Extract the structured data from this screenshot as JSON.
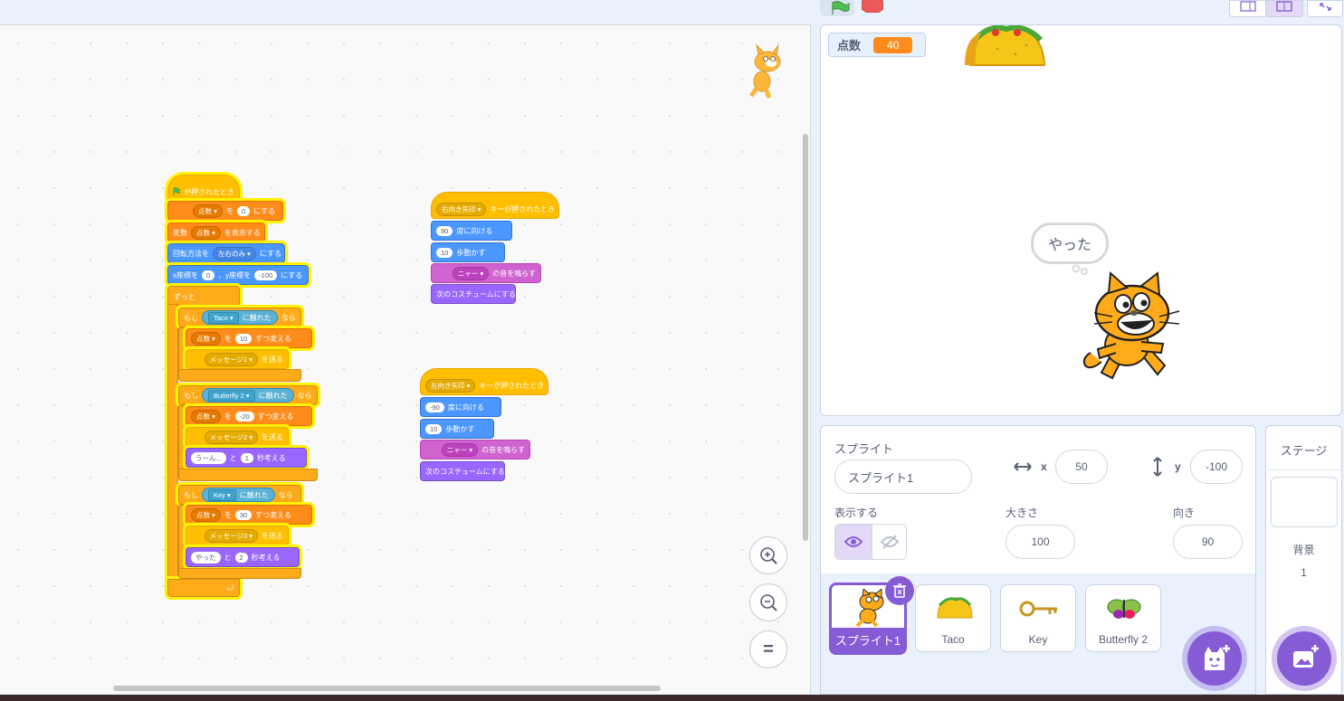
{
  "code": {
    "script1": {
      "hat": "が押されたとき",
      "b1": {
        "var": "点数",
        "text1": "を",
        "value": "0",
        "text2": "にする"
      },
      "b2": {
        "text1": "変数",
        "var": "点数",
        "text2": "を表示する"
      },
      "b3": {
        "text1": "回転方法を",
        "option": "左右のみ",
        "text2": "にする"
      },
      "b4": {
        "text1": "x座標を",
        "x": "0",
        "text2": "、y座標を",
        "y": "-100",
        "text3": "にする"
      },
      "forever": "ずっと",
      "if1": {
        "if": "もし",
        "target": "Taco",
        "touch": "に触れた",
        "then": "なら",
        "change": {
          "var": "点数",
          "text1": "を",
          "value": "10",
          "text2": "ずつ変える"
        },
        "broadcast": {
          "msg": "メッセージ1",
          "text": "を送る"
        }
      },
      "if2": {
        "if": "もし",
        "target": "Butterfly 2",
        "touch": "に触れた",
        "then": "なら",
        "change": {
          "var": "点数",
          "text1": "を",
          "value": "-20",
          "text2": "ずつ変える"
        },
        "broadcast": {
          "msg": "メッセージ2",
          "text": "を送る"
        },
        "think": {
          "msg": "うーん...",
          "text1": "と",
          "secs": "1",
          "text2": "秒考える"
        }
      },
      "if3": {
        "if": "もし",
        "target": "Key",
        "touch": "に触れた",
        "then": "なら",
        "change": {
          "var": "点数",
          "text1": "を",
          "value": "30",
          "text2": "ずつ変える"
        },
        "broadcast": {
          "msg": "メッセージ3",
          "text": "を送る"
        },
        "think": {
          "msg": "やった",
          "text1": "と",
          "secs": "2",
          "text2": "秒考える"
        }
      }
    },
    "script2": {
      "hat": {
        "key": "右向き矢印",
        "text": "キーが押されたとき"
      },
      "point": {
        "value": "90",
        "text": "度に向ける"
      },
      "move": {
        "value": "10",
        "text": "歩動かす"
      },
      "sound": {
        "sound": "ニャー",
        "text": "の音を鳴らす"
      },
      "costume": "次のコスチュームにする"
    },
    "script3": {
      "hat": {
        "key": "左向き矢印",
        "text": "キーが押されたとき"
      },
      "point": {
        "value": "-90",
        "text": "度に向ける"
      },
      "move": {
        "value": "10",
        "text": "歩動かす"
      },
      "sound": {
        "sound": "ニャー",
        "text": "の音を鳴らす"
      },
      "costume": "次のコスチュームにする"
    }
  },
  "zoom": {
    "in": "+",
    "out": "−",
    "reset": "="
  },
  "stage": {
    "monitor_label": "点数",
    "monitor_value": "40",
    "bubble": "やった"
  },
  "sprite_info": {
    "sprite_label": "スプライト",
    "sprite_name": "スプライト1",
    "x_label": "x",
    "x_value": "50",
    "y_label": "y",
    "y_value": "-100",
    "show_label": "表示する",
    "size_label": "大きさ",
    "size_value": "100",
    "direction_label": "向き",
    "direction_value": "90"
  },
  "sprites": [
    {
      "name": "スプライト1"
    },
    {
      "name": "Taco"
    },
    {
      "name": "Key"
    },
    {
      "name": "Butterfly 2"
    }
  ],
  "stage_pane": {
    "title": "ステージ",
    "backdrop_label": "背景",
    "backdrop_count": "1"
  },
  "colors": {
    "accent": "#855cd6",
    "events": "#ffbf00",
    "variables": "#ff8c1a",
    "motion": "#4c97ff",
    "control": "#ffab19",
    "sound": "#cf63cf",
    "looks": "#9966ff",
    "sensing": "#5cb1d6"
  }
}
